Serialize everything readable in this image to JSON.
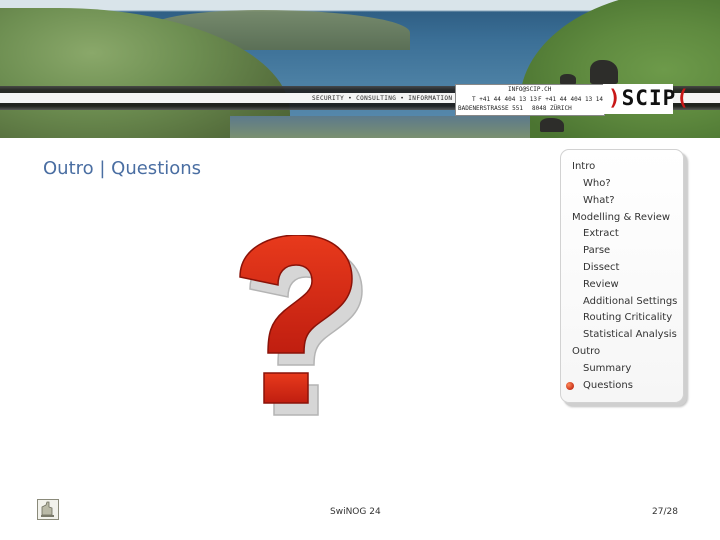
{
  "header": {
    "tagline": "SECURITY • CONSULTING • INFORMATION • PROCESS",
    "contact": {
      "email": "INFO@SCIP.CH",
      "phone": "T +41 44 404 13 13",
      "fax": "F +41 44 404 13 14",
      "address": "BADENERSTRASSE 551",
      "city": "8048 ZÜRICH"
    },
    "logo": {
      "open": ")",
      "text": "SCIP",
      "close": "("
    }
  },
  "slide": {
    "title": "Outro | Questions"
  },
  "agenda": {
    "items": [
      {
        "label": "Intro",
        "level": 0
      },
      {
        "label": "Who?",
        "level": 1
      },
      {
        "label": "What?",
        "level": 1
      },
      {
        "label": "Modelling & Review",
        "level": 0
      },
      {
        "label": "Extract",
        "level": 1
      },
      {
        "label": "Parse",
        "level": 1
      },
      {
        "label": "Dissect",
        "level": 1
      },
      {
        "label": "Review",
        "level": 1
      },
      {
        "label": "Additional Settings",
        "level": 1
      },
      {
        "label": "Routing Criticality",
        "level": 1
      },
      {
        "label": "Statistical Analysis",
        "level": 1
      },
      {
        "label": "Outro",
        "level": 0
      },
      {
        "label": "Summary",
        "level": 1
      },
      {
        "label": "Questions",
        "level": 1,
        "current": true
      }
    ],
    "bullet_color": "#c8321a"
  },
  "footer": {
    "event": "SwiNOG 24",
    "page": "27/28"
  },
  "colors": {
    "title": "#4a6ea2",
    "question_mark": "#d42a14",
    "question_mark_shadow": "#cfcfcf"
  },
  "icons": {
    "footer_icon": "document-icon",
    "main_graphic": "question-mark-icon"
  }
}
